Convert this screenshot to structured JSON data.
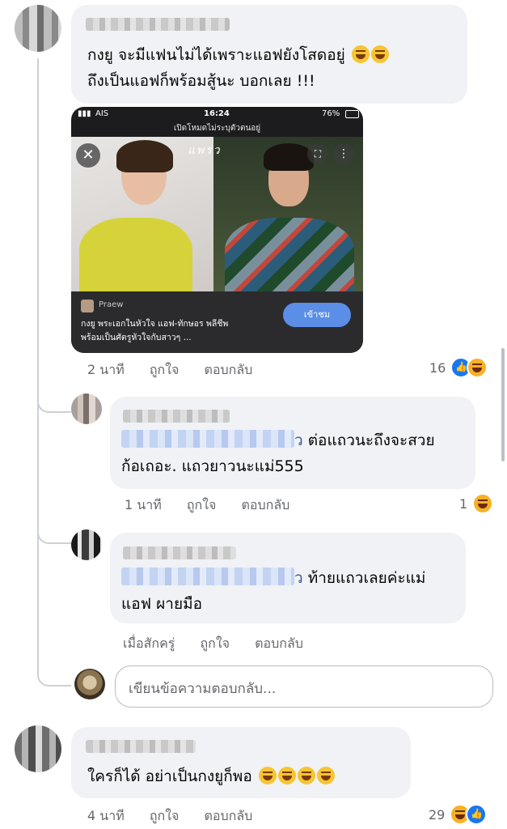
{
  "comments": [
    {
      "text_line1": "กงยู จะมีแฟนไม่ได้เพราะแอฟยังโสดอยู่",
      "text_line2": "ถึงเป็นแอฟก็พร้อมสู้นะ บอกเลย !!!",
      "time": "2 นาที",
      "like": "ถูกใจ",
      "reply": "ตอบกลับ",
      "reaction_count": "16",
      "reactions": [
        "like-icon",
        "haha-icon"
      ],
      "attachment": {
        "status_carrier": "AIS",
        "status_time": "16:24",
        "status_battery": "76%",
        "incognito_banner": "เปิดโหมดไม่ระบุตัวตนอยู่",
        "magazine_logo": "แพรว",
        "source_name": "Praew",
        "headline_line1": "กงยู พระเอกในหัวใจ แอฟ-ทักษอร พลีชีพ",
        "headline_line2": "พร้อมเป็นศัตรูหัวใจกับสาวๆ ...",
        "view_button": "เข้าชม"
      }
    },
    {
      "mention_tail": "ว",
      "text_line1": "ต่อแถวนะถึงจะสวย",
      "text_line2": "ก้อเถอะ. แถวยาวนะแม่555",
      "time": "1 นาที",
      "like": "ถูกใจ",
      "reply": "ตอบกลับ",
      "reaction_count": "1",
      "reactions": [
        "haha-icon"
      ]
    },
    {
      "mention_tail": "ว",
      "text_line1": "ท้ายแถวเลยค่ะแม่",
      "text_line2": "แอฟ ผายมือ",
      "time": "เมื่อสักครู่",
      "like": "ถูกใจ",
      "reply": "ตอบกลับ"
    },
    {
      "text_line1": "ใครก็ได้ อย่าเป็นกงยูก็พอ",
      "time": "4 นาที",
      "like": "ถูกใจ",
      "reply": "ตอบกลับ",
      "reaction_count": "29",
      "reactions": [
        "haha-icon",
        "like-icon"
      ]
    }
  ],
  "reply_box": {
    "placeholder": "เขียนข้อความตอบกลับ..."
  },
  "colors": {
    "bubble": "#f0f2f5",
    "meta_text": "#65676b",
    "like_blue": "#1877f2",
    "haha_yellow": "#f7b125",
    "view_button": "#5b8ee6"
  }
}
